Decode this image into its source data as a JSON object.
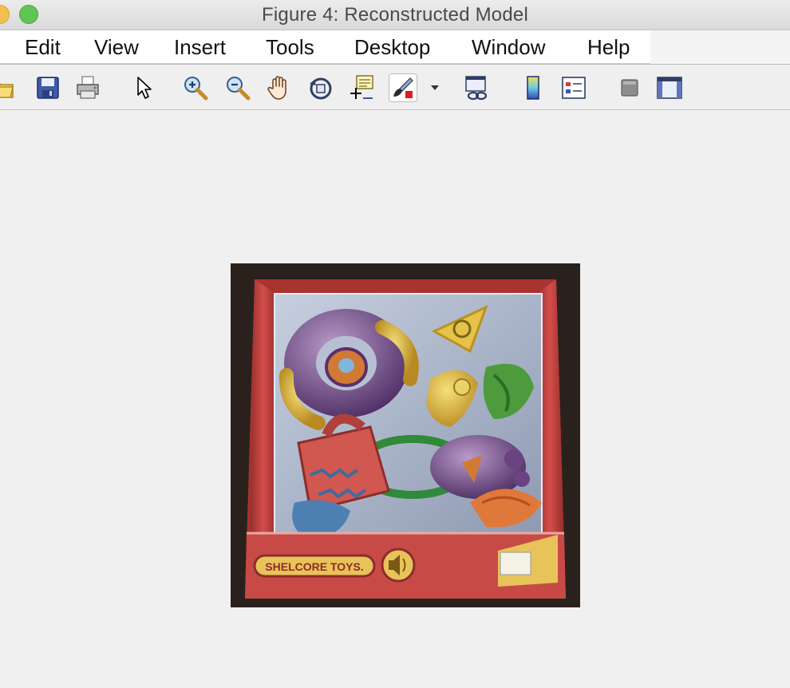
{
  "window": {
    "title": "Figure 4: Reconstructed Model"
  },
  "menu": {
    "items": [
      {
        "label": "Edit"
      },
      {
        "label": "View"
      },
      {
        "label": "Insert"
      },
      {
        "label": "Tools"
      },
      {
        "label": "Desktop"
      },
      {
        "label": "Window"
      },
      {
        "label": "Help"
      }
    ]
  },
  "toolbar": {
    "icons": [
      "open-folder-icon",
      "save-icon",
      "print-icon",
      "edit-plot-arrow-icon",
      "zoom-in-icon",
      "zoom-out-icon",
      "pan-hand-icon",
      "rotate-3d-icon",
      "data-cursor-icon",
      "brush-icon",
      "brush-dropdown-icon",
      "link-plot-icon",
      "insert-colorbar-icon",
      "insert-legend-icon",
      "hide-plot-tools-icon",
      "show-plot-tools-icon"
    ]
  },
  "image": {
    "printed_text": "SHELCORE TOYS.",
    "colors": {
      "box_red": "#c8423f",
      "tray_blue": "#aeb8cc",
      "banner_yellow": "#e8c35a",
      "background_dark": "#2a211d"
    }
  }
}
